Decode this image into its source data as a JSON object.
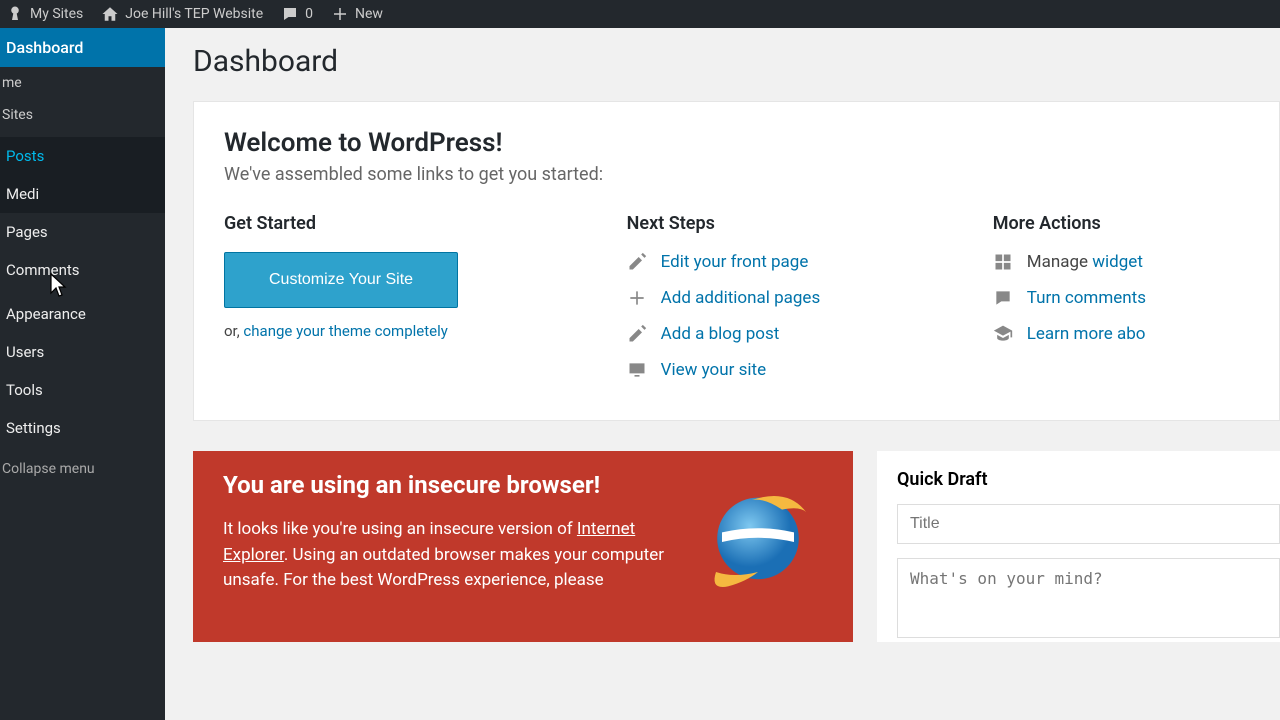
{
  "topbar": {
    "my_sites": "My Sites",
    "site_name": "Joe Hill's TEP Website",
    "comments_count": "0",
    "new_label": "New"
  },
  "sidebar": {
    "dashboard": "Dashboard",
    "home": "me",
    "my_sites": "Sites",
    "posts": "Posts",
    "media": "Medi",
    "pages": "Pages",
    "comments": "Comments",
    "appearance": "Appearance",
    "users": "Users",
    "tools": "Tools",
    "settings": "Settings",
    "collapse": "Collapse menu"
  },
  "page": {
    "title": "Dashboard"
  },
  "welcome": {
    "title": "Welcome to WordPress!",
    "subtitle": "We've assembled some links to get you started:",
    "get_started_heading": "Get Started",
    "customize_btn": "Customize Your Site",
    "or_prefix": "or, ",
    "change_theme": "change your theme completely",
    "next_steps_heading": "Next Steps",
    "edit_front": "Edit your front page",
    "add_pages": "Add additional pages",
    "add_post": "Add a blog post",
    "view_site": "View your site",
    "more_actions_heading": "More Actions",
    "manage_prefix": "Manage ",
    "manage_link": "widget",
    "turn_comments": "Turn comments",
    "learn_more": "Learn more abo"
  },
  "warning": {
    "title": "You are using an insecure browser!",
    "body_1": "It looks like you're using an insecure version of ",
    "ie_link": "Internet Explorer",
    "body_2": ". Using an outdated browser makes your computer unsafe. For the best WordPress experience, please"
  },
  "quickdraft": {
    "heading": "Quick Draft",
    "title_placeholder": "Title",
    "content_placeholder": "What's on your mind?"
  }
}
